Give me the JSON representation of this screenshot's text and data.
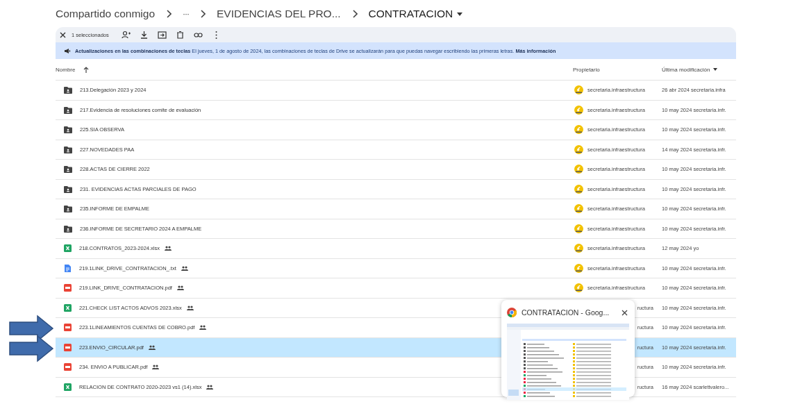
{
  "breadcrumb": [
    {
      "label": "Compartido conmigo",
      "kind": "link"
    },
    {
      "label": "···",
      "kind": "more"
    },
    {
      "label": "EVIDENCIAS DEL PRO...",
      "kind": "link"
    },
    {
      "label": "CONTRATACION",
      "kind": "current"
    }
  ],
  "selection_bar": {
    "count": "1 seleccionados"
  },
  "banner": {
    "title": "Actualizaciones en las combinaciones de teclas",
    "text": "El jueves, 1 de agosto de 2024, las combinaciones de teclas de Drive se actualizarán para que puedas navegar escribiendo las primeras letras.",
    "link": "Más información"
  },
  "columns": {
    "name": "Nombre",
    "owner": "Propietario",
    "modified": "Última modificación"
  },
  "files": [
    {
      "kind": "folder",
      "name": "213.Delegación 2023 y 2024",
      "shared": false,
      "selected": false,
      "owner": "secretaria.infraestructura",
      "owner_avatar": true,
      "modified": "26 abr 2024 secretaria.infra"
    },
    {
      "kind": "folder",
      "name": "217.Evidencia de resoluciones comite de evaluación",
      "shared": false,
      "selected": false,
      "owner": "secretaria.infraestructura",
      "owner_avatar": true,
      "modified": "10 may 2024 secretaria.infr."
    },
    {
      "kind": "folder",
      "name": "225.SIA OBSERVA",
      "shared": false,
      "selected": false,
      "owner": "secretaria.infraestructura",
      "owner_avatar": true,
      "modified": "10 may 2024 secretaria.infr."
    },
    {
      "kind": "folder",
      "name": "227.NOVEDADES PAA",
      "shared": false,
      "selected": false,
      "owner": "secretaria.infraestructura",
      "owner_avatar": true,
      "modified": "14 may 2024 secretaria.infr."
    },
    {
      "kind": "folder",
      "name": "228.ACTAS DE CIERRE 2022",
      "shared": false,
      "selected": false,
      "owner": "secretaria.infraestructura",
      "owner_avatar": true,
      "modified": "10 may 2024 secretaria.infr."
    },
    {
      "kind": "folder",
      "name": "231. EVIDENCIAS ACTAS PARCIALES DE PAGO",
      "shared": false,
      "selected": false,
      "owner": "secretaria.infraestructura",
      "owner_avatar": true,
      "modified": "10 may 2024 secretaria.infr."
    },
    {
      "kind": "folder",
      "name": "235.INFORME DE EMPALME",
      "shared": false,
      "selected": false,
      "owner": "secretaria.infraestructura",
      "owner_avatar": true,
      "modified": "10 may 2024 secretaria.infr."
    },
    {
      "kind": "folder",
      "name": "236.INFORME DE SECRETARIO 2024 A EMPALME",
      "shared": false,
      "selected": false,
      "owner": "secretaria.infraestructura",
      "owner_avatar": true,
      "modified": "10 may 2024 secretaria.infr."
    },
    {
      "kind": "sheet",
      "name": "218.CONTRATOS_2023-2024.xlsx",
      "shared": true,
      "selected": false,
      "owner": "secretaria.infraestructura",
      "owner_avatar": true,
      "modified": "12 may 2024 yo"
    },
    {
      "kind": "doc",
      "name": "219.1LINK_DRIVE_CONTRATACION_.txt",
      "shared": true,
      "selected": false,
      "owner": "secretaria.infraestructura",
      "owner_avatar": true,
      "modified": "10 may 2024 secretaria.infr."
    },
    {
      "kind": "pdf",
      "name": "219.LINK_DRIVE_CONTRATACION.pdf",
      "shared": true,
      "selected": false,
      "owner": "secretaria.infraestructura",
      "owner_avatar": true,
      "modified": "10 may 2024 secretaria.infr."
    },
    {
      "kind": "sheet",
      "name": "221.CHECK LIST ACTOS ADVOS 2023.xlsx",
      "shared": true,
      "selected": false,
      "owner": "ructura",
      "owner_avatar": false,
      "modified": "10 may 2024 secretaria.infr."
    },
    {
      "kind": "pdf",
      "name": "223.1LINEAMIENTOS CUENTAS DE COBRO.pdf",
      "shared": true,
      "selected": false,
      "owner": "ructura",
      "owner_avatar": false,
      "modified": "10 may 2024 secretaria.infr."
    },
    {
      "kind": "pdf",
      "name": "223.ENVIO_CIRCULAR.pdf",
      "shared": true,
      "selected": true,
      "owner": "ructura",
      "owner_avatar": false,
      "modified": "10 may 2024 secretaria.infr."
    },
    {
      "kind": "pdf",
      "name": "234. ENVIO A PUBLICAR.pdf",
      "shared": true,
      "selected": false,
      "owner": "ructura",
      "owner_avatar": false,
      "modified": "10 may 2024 secretaria.infr."
    },
    {
      "kind": "sheet",
      "name": "RELACION DE CONTRATO 2020-2023 vs1 (14).xlsx",
      "shared": true,
      "selected": false,
      "owner": "ructura",
      "owner_avatar": false,
      "modified": "16 may 2024 scarlettvalero..."
    }
  ],
  "preview_popup": {
    "title": "CONTRATACION - Goog..."
  },
  "arrow_pointed": [
    false,
    false,
    false,
    false,
    false,
    false,
    false,
    false,
    false,
    false,
    false,
    false,
    true,
    true,
    false,
    false
  ]
}
